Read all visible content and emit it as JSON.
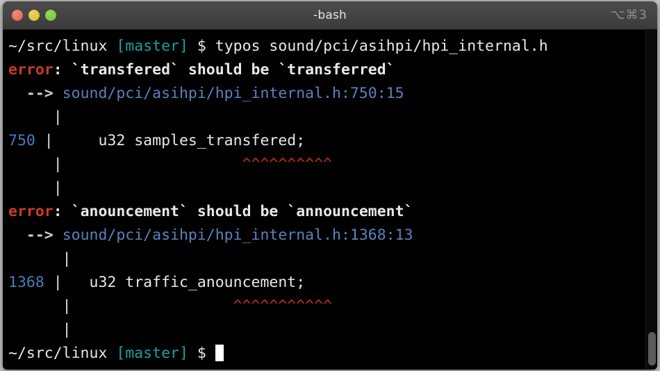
{
  "window": {
    "title": "-bash",
    "shortcut": "⌥⌘3",
    "traffic_lights": {
      "close": "close-button",
      "minimize": "minimize-button",
      "maximize": "maximize-button"
    },
    "colors": {
      "close": "#ec6a5e",
      "minimize": "#e3c03c",
      "maximize": "#7bc93f",
      "titlebar": "#444444",
      "background": "#000000",
      "error": "#cc3b25",
      "path": "#5a82bd",
      "branch": "#17a2a2",
      "line_number": "#4a7cb8",
      "caret": "#c3331a",
      "text": "#e8e8e8"
    }
  },
  "terminal": {
    "prompt": {
      "path": "~/src/linux",
      "branch": "[master]",
      "sigil": "$"
    },
    "command": "typos sound/pci/asihpi/hpi_internal.h",
    "errors": [
      {
        "label": "error",
        "colon": ":",
        "message": "`transfered` should be `transferred`",
        "arrow": "-->",
        "location": "sound/pci/asihpi/hpi_internal.h:750:15",
        "gutter_blank": "     |",
        "line_number": "750",
        "code": "    u32 samples_transfered;",
        "carets": "^^^^^^^^^^",
        "caret_indent": "                   "
      },
      {
        "label": "error",
        "colon": ":",
        "message": "`anouncement` should be `announcement`",
        "arrow": "-->",
        "location": "sound/pci/asihpi/hpi_internal.h:1368:13",
        "gutter_blank": "      |",
        "line_number": "1368",
        "code": "  u32 traffic_anouncement;",
        "carets": "^^^^^^^^^^^",
        "caret_indent": "                 "
      }
    ],
    "final_prompt": {
      "path": "~/src/linux",
      "branch": "[master]",
      "sigil": "$"
    },
    "scrollbar": {
      "thumb": "scroll-thumb"
    }
  }
}
